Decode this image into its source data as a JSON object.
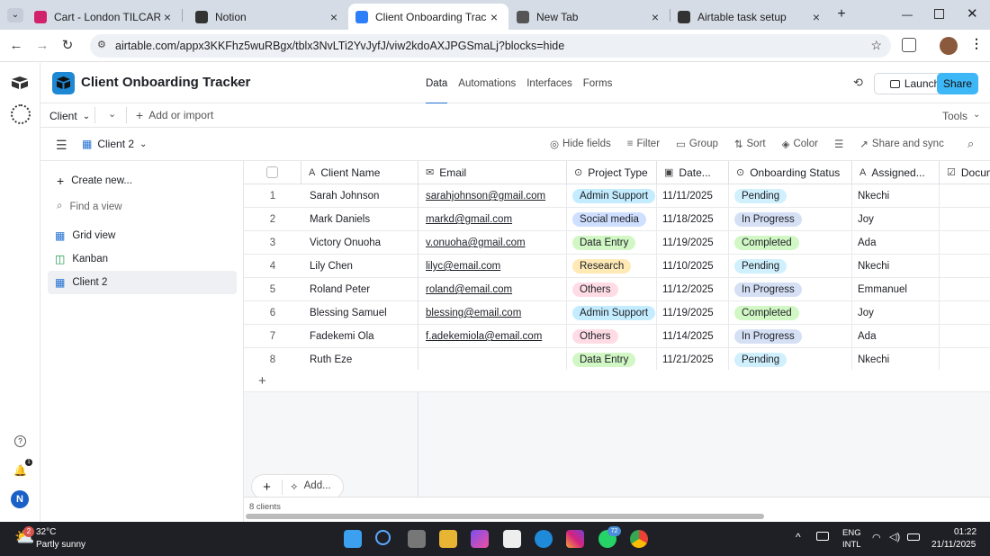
{
  "browser": {
    "tabs": [
      {
        "title": "Cart - London TILCAREER In",
        "icon": "tilcareer-icon",
        "color": "#d1236b"
      },
      {
        "title": "Notion",
        "icon": "notion-icon",
        "color": "#333"
      },
      {
        "title": "Client Onboarding Tracker: C",
        "icon": "airtable-icon",
        "color": "#2d7ff9"
      },
      {
        "title": "New Tab",
        "icon": "chrome-icon",
        "color": "#555"
      },
      {
        "title": "Airtable task setup",
        "icon": "openai-icon",
        "color": "#333"
      }
    ],
    "url": "airtable.com/appx3KKFhz5wuRBgx/tblx3NvLTi2YvJyfJ/viw2kdoAXJPGSmaLj?blocks=hide"
  },
  "base": {
    "title": "Client Onboarding Tracker",
    "nav": [
      "Data",
      "Automations",
      "Interfaces",
      "Forms"
    ],
    "launch": "Launch",
    "share": "Share"
  },
  "table_bar": {
    "table": "Client",
    "add": "Add or import",
    "tools": "Tools"
  },
  "view_bar": {
    "view": "Client 2",
    "hide": "Hide fields",
    "filter": "Filter",
    "group": "Group",
    "sort": "Sort",
    "color": "Color",
    "share": "Share and sync"
  },
  "sidebar": {
    "create": "Create new...",
    "find": "Find a view",
    "views": [
      "Grid view",
      "Kanban",
      "Client 2"
    ]
  },
  "grid": {
    "columns": [
      "Client Name",
      "Email",
      "Project Type",
      "Date...",
      "Onboarding Status",
      "Assigned...",
      "Docum"
    ],
    "rows": [
      {
        "n": "1",
        "name": "Sarah Johnson",
        "email": "sarahjohnson@gmail.com",
        "type": "Admin Support",
        "date": "11/11/2025",
        "status": "Pending",
        "assigned": "Nkechi"
      },
      {
        "n": "2",
        "name": "Mark Daniels",
        "email": "markd@gmail.com",
        "type": "Social media",
        "date": "11/18/2025",
        "status": "In Progress",
        "assigned": "Joy"
      },
      {
        "n": "3",
        "name": "Victory Onuoha",
        "email": "v.onuoha@gmail.com",
        "type": "Data Entry",
        "date": "11/19/2025",
        "status": "Completed",
        "assigned": "Ada"
      },
      {
        "n": "4",
        "name": "Lily Chen",
        "email": "lilyc@email.com",
        "type": "Research",
        "date": "11/10/2025",
        "status": "Pending",
        "assigned": "Nkechi"
      },
      {
        "n": "5",
        "name": "Roland Peter",
        "email": "roland@email.com",
        "type": "Others",
        "date": "11/12/2025",
        "status": "In Progress",
        "assigned": "Emmanuel"
      },
      {
        "n": "6",
        "name": "Blessing Samuel",
        "email": "blessing@email.com",
        "type": "Admin Support",
        "date": "11/19/2025",
        "status": "Completed",
        "assigned": "Joy"
      },
      {
        "n": "7",
        "name": "Fadekemi Ola",
        "email": "f.adekemiola@email.com",
        "type": "Others",
        "date": "11/14/2025",
        "status": "In Progress",
        "assigned": "Ada"
      },
      {
        "n": "8",
        "name": "Ruth Eze",
        "email": "",
        "type": "Data Entry",
        "date": "11/21/2025",
        "status": "Pending",
        "assigned": "Nkechi"
      }
    ],
    "add_label": "Add...",
    "count": "8 clients"
  },
  "type_colors": {
    "Admin Support": "#c4ecff",
    "Social media": "#cfdfff",
    "Data Entry": "#d1f7c4",
    "Research": "#ffeab6",
    "Others": "#ffdce5"
  },
  "status_colors": {
    "Pending": "#d0f0fd",
    "In Progress": "#d6e0f5",
    "Completed": "#d1f7c4"
  },
  "taskbar": {
    "temp": "32°C",
    "weather": "Partly sunny",
    "badge": "2",
    "lang1": "ENG",
    "lang2": "INTL",
    "time": "01:22",
    "date": "21/11/2025",
    "whatsapp_badge": "72"
  },
  "profile_initial": "N"
}
